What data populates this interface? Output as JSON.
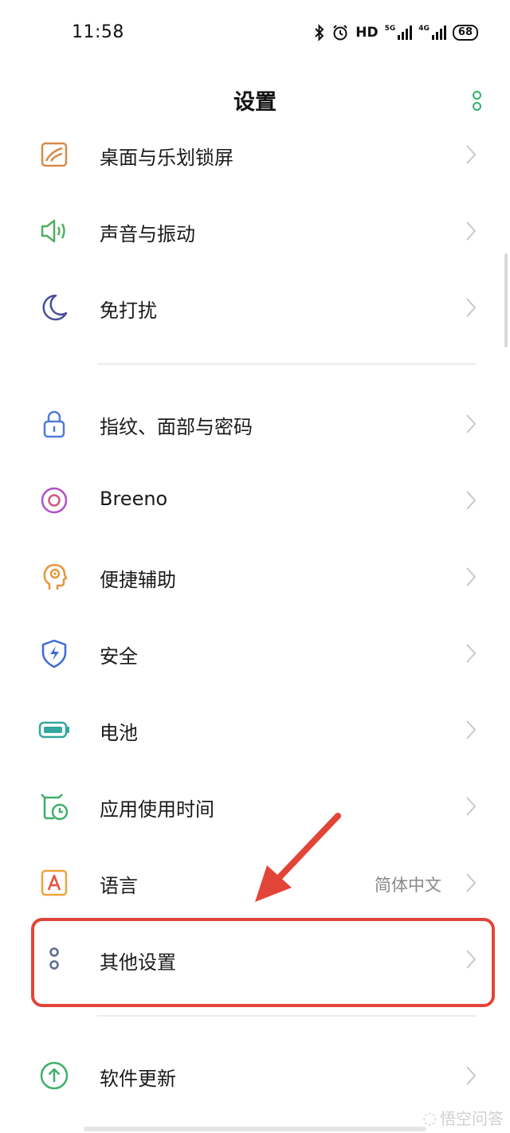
{
  "status_bar": {
    "time": "11:58",
    "hd": "HD",
    "network_1": "5G",
    "network_2": "4G",
    "battery": "68"
  },
  "header": {
    "title": "设置"
  },
  "settings": [
    {
      "label": "桌面与乐划锁屏",
      "icon": "wallpaper-icon",
      "color": "#d9894a"
    },
    {
      "label": "声音与振动",
      "icon": "speaker-icon",
      "color": "#4fae5f"
    },
    {
      "label": "免打扰",
      "icon": "moon-icon",
      "color": "#4b4f9c"
    },
    {
      "label": "指纹、面部与密码",
      "icon": "lock-icon",
      "color": "#4c7bd9"
    },
    {
      "label": "Breeno",
      "icon": "breeno-icon",
      "color": "#b04fc9"
    },
    {
      "label": "便捷辅助",
      "icon": "head-icon",
      "color": "#e6963c"
    },
    {
      "label": "安全",
      "icon": "shield-icon",
      "color": "#3d6bd1"
    },
    {
      "label": "电池",
      "icon": "battery-icon",
      "color": "#33a79e"
    },
    {
      "label": "应用使用时间",
      "icon": "app-time-icon",
      "color": "#3fb06a"
    },
    {
      "label": "语言",
      "value": "简体中文",
      "icon": "language-icon",
      "color": "#f0a23a"
    },
    {
      "label": "其他设置",
      "icon": "other-settings-icon",
      "color": "#5c6c8f"
    },
    {
      "label": "软件更新",
      "icon": "update-icon",
      "color": "#3fb06a"
    }
  ],
  "annotation": {
    "color": "#e24537"
  },
  "watermark": "悟空问答"
}
